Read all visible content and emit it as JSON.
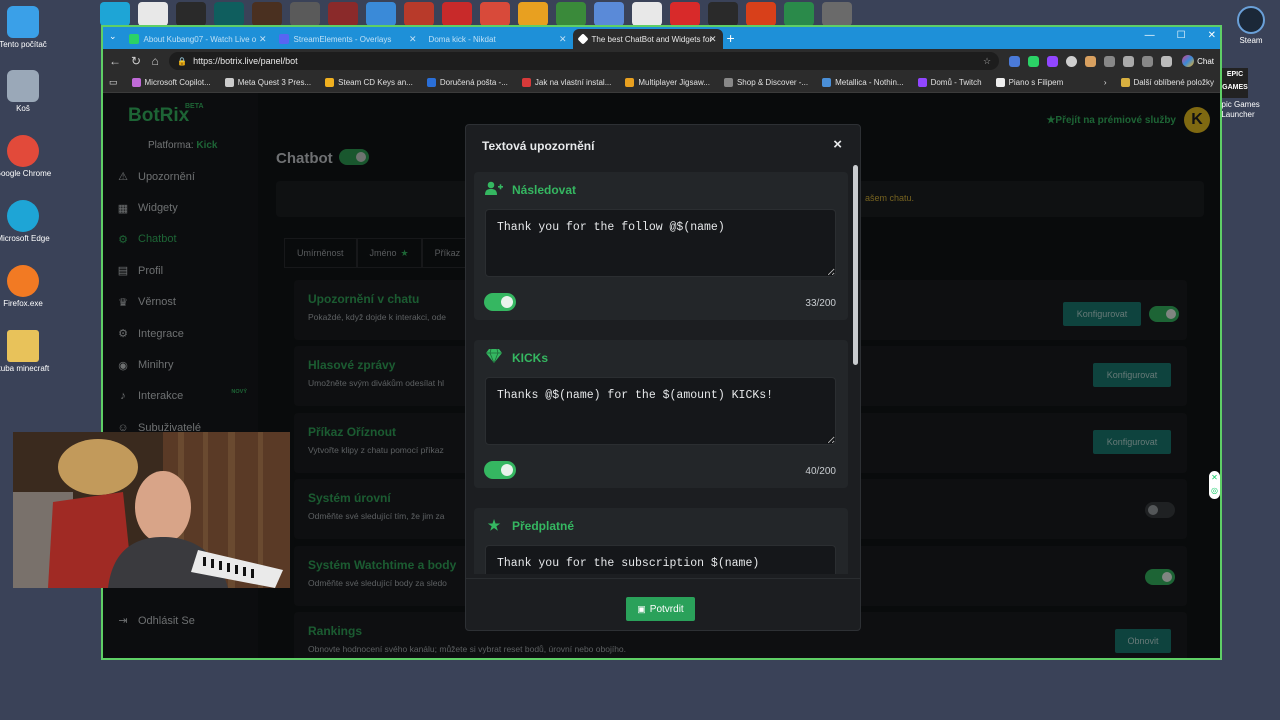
{
  "desktop": {
    "left_icons": [
      {
        "label": "Tento počítač",
        "color": "#3aa0e8"
      },
      {
        "label": "Koš",
        "color": "#9aa8b8"
      },
      {
        "label": "Google Chrome",
        "color": "#e24a3a"
      },
      {
        "label": "Microsoft Edge",
        "color": "#1ea5d6"
      },
      {
        "label": "Firefox.exe",
        "color": "#f27a23"
      },
      {
        "label": "kuba minecraft",
        "color": "#e8c25a"
      }
    ],
    "right_icons": [
      {
        "label": "Steam"
      },
      {
        "label": "Epic Games Launcher"
      }
    ],
    "epic_label": "EPIC GAMES"
  },
  "browser": {
    "tabs": [
      {
        "label": "About Kubang07 - Watch Live o",
        "active": false,
        "fav": "#2bd266"
      },
      {
        "label": "StreamElements - Overlays",
        "active": false,
        "fav": "#5865f2"
      },
      {
        "label": "Doma kick - Nikdat",
        "active": false,
        "fav": "#1e90d8"
      },
      {
        "label": "The best ChatBot and Widgets for",
        "active": true,
        "fav": "#ffffff"
      }
    ],
    "url": "https://botrix.live/panel/bot",
    "chat_label": "Chat",
    "bookmarks": [
      {
        "label": "Microsoft Copilot...",
        "color": "#c06ad8"
      },
      {
        "label": "Meta Quest 3 Pres...",
        "color": "#cccccc"
      },
      {
        "label": "Steam CD Keys an...",
        "color": "#f0b020"
      },
      {
        "label": "Doručená pošta -...",
        "color": "#2a6fd8"
      },
      {
        "label": "Jak na vlastní instal...",
        "color": "#d83a3a"
      },
      {
        "label": "Multiplayer Jigsaw...",
        "color": "#e8a020"
      },
      {
        "label": "Shop & Discover -...",
        "color": "#888888"
      },
      {
        "label": "Metallica - Nothin...",
        "color": "#4a8fd8"
      },
      {
        "label": "Domů - Twitch",
        "color": "#9146ff"
      },
      {
        "label": "Piano s Filipem",
        "color": "#eeeeee"
      }
    ],
    "bookmarks_other": "Další oblíbené položky"
  },
  "app": {
    "logo": "BotRix",
    "beta": "BETA",
    "platform_label": "Platforma:",
    "platform_value": "Kick",
    "premium": "★Přejít na prémiové služby",
    "menu": [
      {
        "label": "Upozornění",
        "icon": "⚠",
        "active": false
      },
      {
        "label": "Widgety",
        "icon": "▦",
        "active": false
      },
      {
        "label": "Chatbot",
        "icon": "⚙",
        "active": true
      },
      {
        "label": "Profil",
        "icon": "▤",
        "active": false
      },
      {
        "label": "Věrnost",
        "icon": "♛",
        "active": false
      },
      {
        "label": "Integrace",
        "icon": "⚙",
        "active": false
      },
      {
        "label": "Minihry",
        "icon": "◉",
        "active": false
      },
      {
        "label": "Interakce",
        "icon": "♪",
        "active": false,
        "badge": "NOVÝ"
      },
      {
        "label": "Subuživatelé",
        "icon": "☺",
        "active": false
      }
    ],
    "logout": "Odhlásit Se",
    "title": "Chatbot",
    "notice_tail": "ašem chatu.",
    "tabs": [
      "Umírněnost",
      "Jméno",
      "Příkaz"
    ],
    "cards": [
      {
        "title": "Upozornění v chatu",
        "desc": "Pokaždé, když dojde k interakci, ode",
        "button": "Konfigurovat",
        "toggle": true
      },
      {
        "title": "Hlasové zprávy",
        "desc": "Umožněte svým divákům odesílat hl",
        "button": "Konfigurovat",
        "toggle": null
      },
      {
        "title": "Příkaz Oříznout",
        "desc": "Vytvořte klipy z chatu pomocí příkaz",
        "button": "Konfigurovat",
        "toggle": null
      },
      {
        "title": "Systém úrovní",
        "desc": "Odměňte své sledující tím, že jim za",
        "button": "",
        "toggle": false
      },
      {
        "title": "Systém Watchtime a body",
        "desc": "Odměňte své sledující body za sledo",
        "button": "",
        "toggle": true
      },
      {
        "title": "Rankings",
        "desc": "Obnovte hodnocení svého kanálu; můžete si vybrat reset bodů, úrovní nebo obojího.",
        "button": "Obnovit",
        "toggle": null
      }
    ]
  },
  "modal": {
    "title": "Textová upozornění",
    "close": "×",
    "sections": [
      {
        "title": "Následovat",
        "icon": "user-plus-icon",
        "glyph": "👤",
        "text": "Thank you for the follow @$(name)",
        "count": "33/200",
        "enabled": true
      },
      {
        "title": "KICKs",
        "icon": "gem-icon",
        "glyph": "◆",
        "text": "Thanks @$(name) for the $(amount) KICKs!",
        "count": "40/200",
        "enabled": true
      },
      {
        "title": "Předplatné",
        "icon": "star-icon",
        "glyph": "★",
        "text": "Thank you for the subscription $(name)",
        "count": "",
        "enabled": true
      }
    ],
    "confirm": "Potvrdit"
  }
}
